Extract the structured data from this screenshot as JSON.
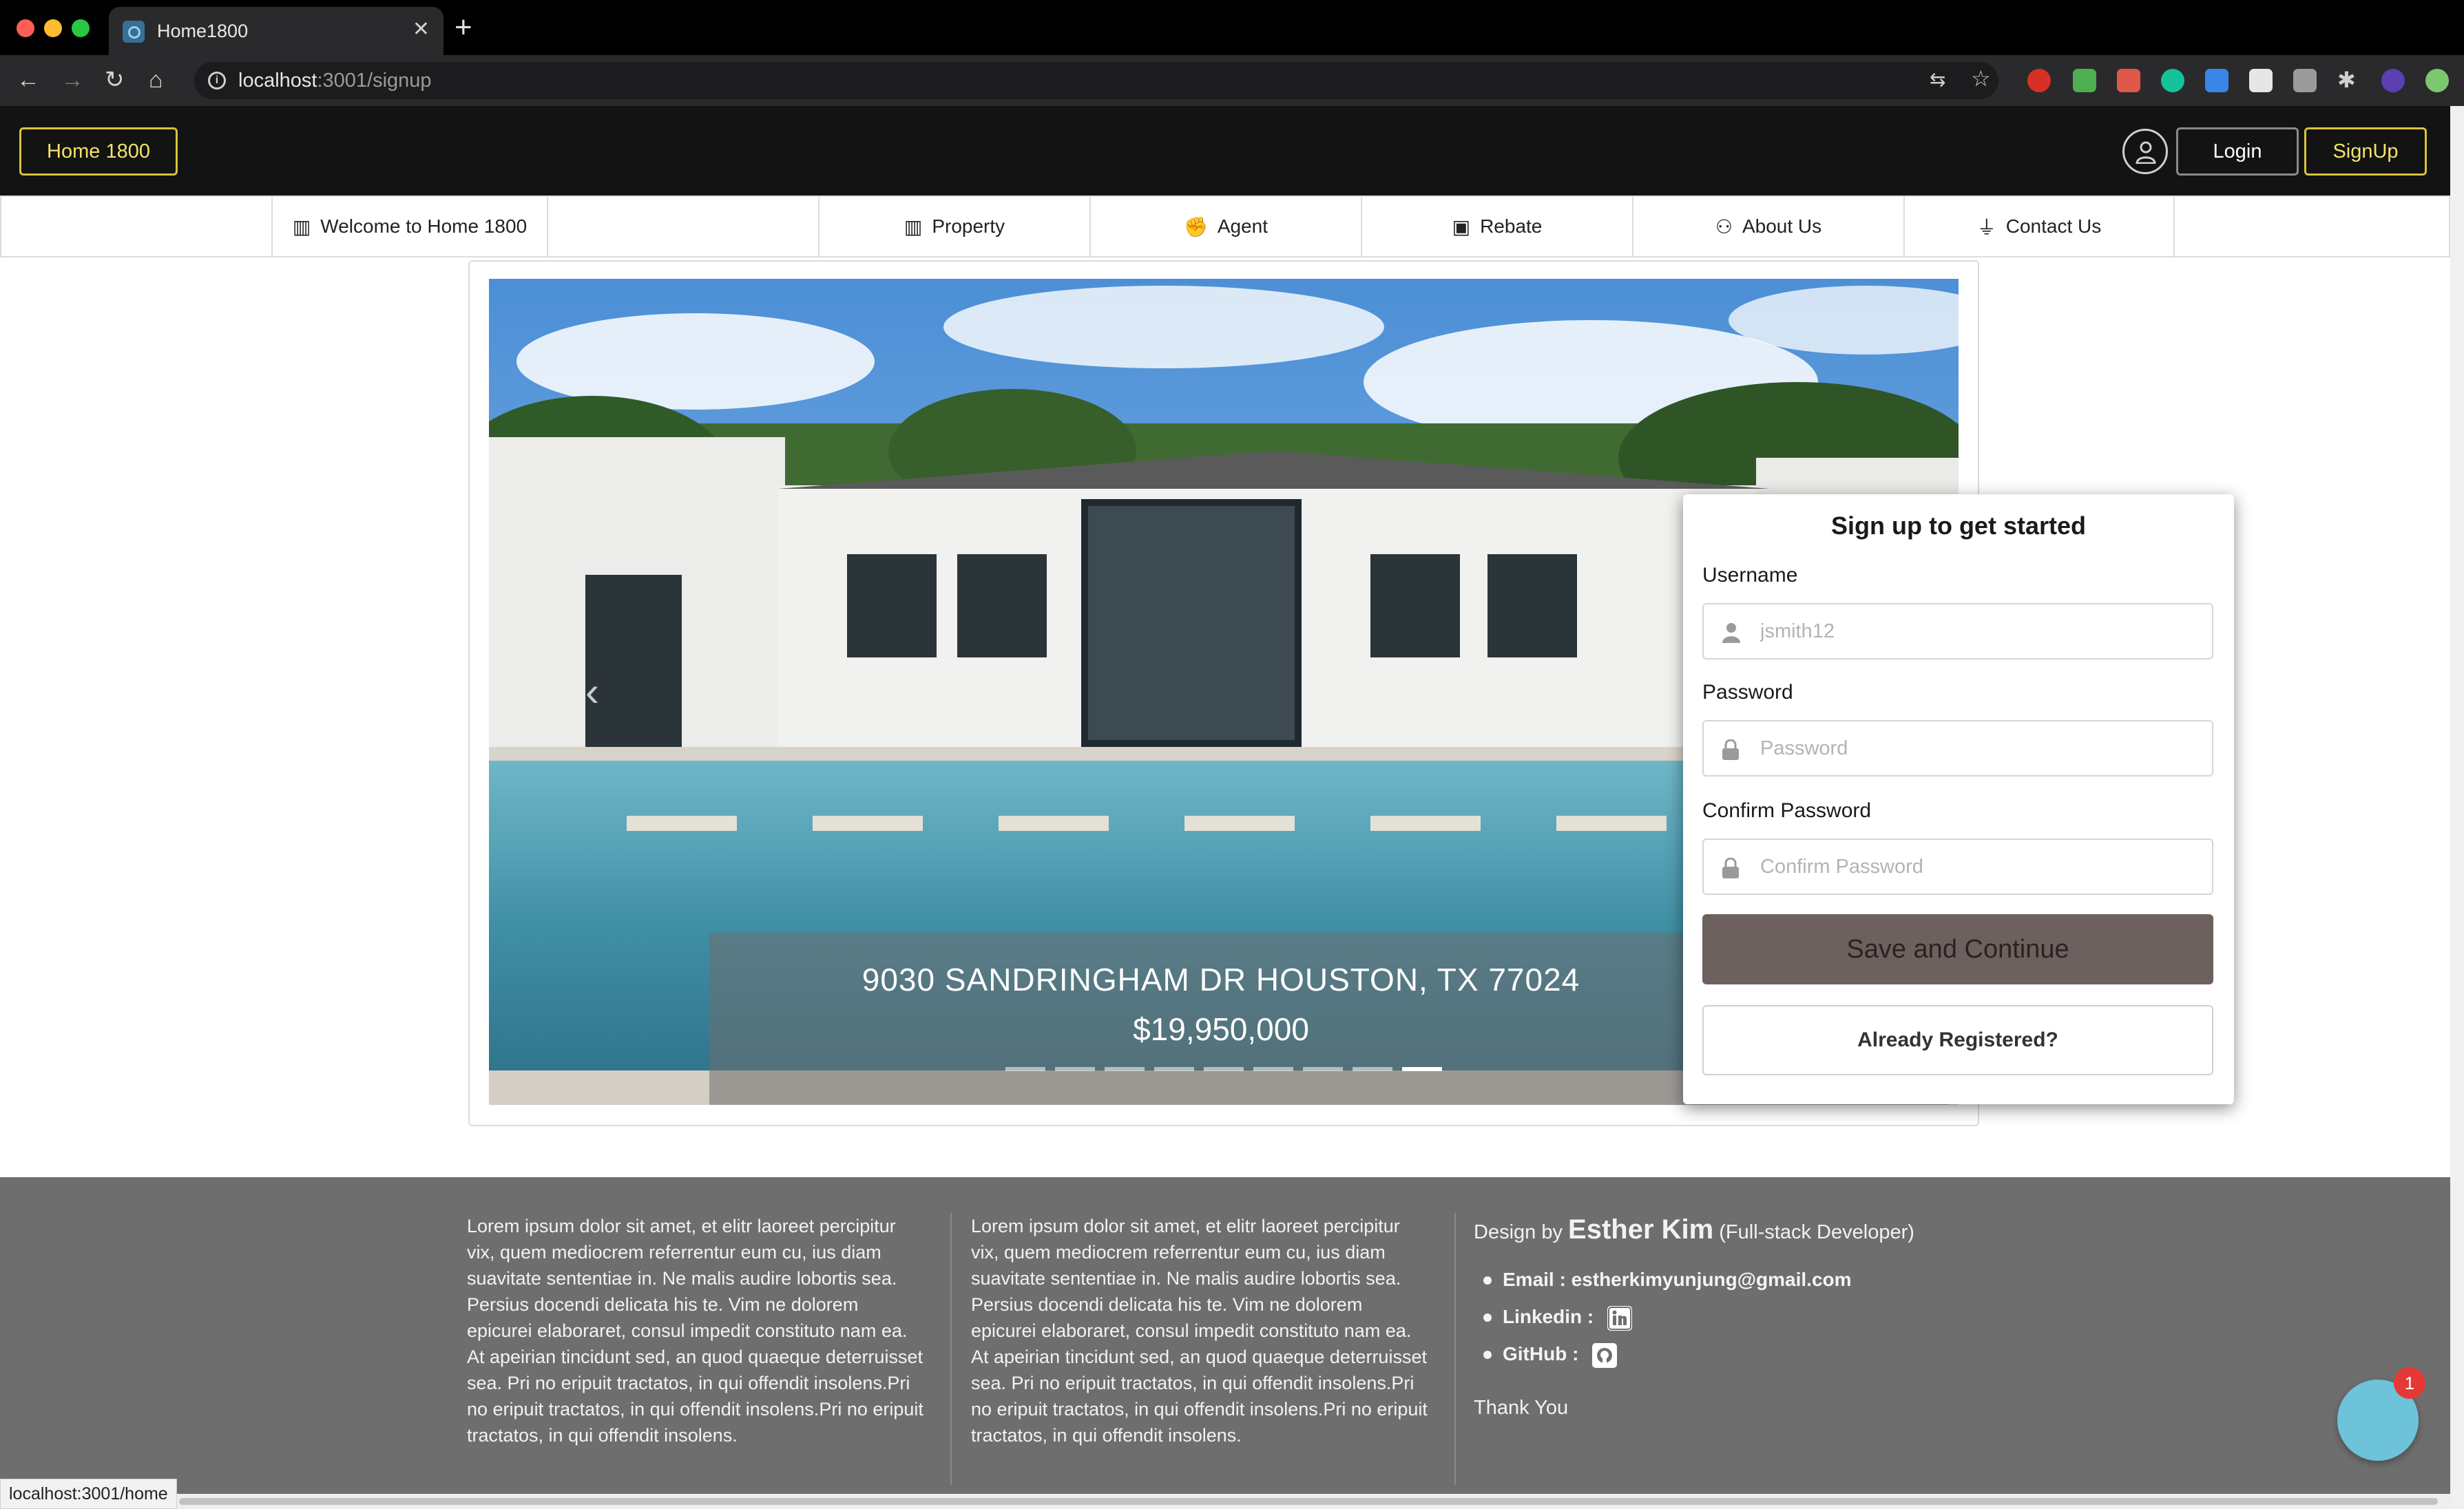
{
  "browser": {
    "tab_title": "Home1800",
    "url_host": "localhost",
    "url_path": ":3001/signup",
    "status_url": "localhost:3001/home",
    "traffic_colors": [
      "#ff5f57",
      "#febc2e",
      "#28c840"
    ]
  },
  "header": {
    "brand": "Home 1800",
    "login": "Login",
    "signup": "SignUp",
    "accent": "#d9c33a"
  },
  "menu": {
    "welcome": "Welcome to Home 1800",
    "property": "Property",
    "agent": "Agent",
    "rebate": "Rebate",
    "about": "About Us",
    "contact": "Contact Us"
  },
  "carousel": {
    "address": "9030 SANDRINGHAM DR HOUSTON, TX 77024",
    "price": "$19,950,000",
    "slide_count": 9,
    "active_index": 8
  },
  "signup_form": {
    "title": "Sign up to get started",
    "username_label": "Username",
    "username_placeholder": "jsmith12",
    "password_label": "Password",
    "password_placeholder": "Password",
    "confirm_label": "Confirm Password",
    "confirm_placeholder": "Confirm Password",
    "submit": "Save and Continue",
    "secondary": "Already Registered?"
  },
  "footer": {
    "lorem": "Lorem ipsum dolor sit amet, et elitr laoreet percipitur vix, quem mediocrem referrentur eum cu, ius diam suavitate sententiae in. Ne malis audire lobortis sea. Persius docendi delicata his te. Vim ne dolorem epicurei elaboraret, consul impedit constituto nam ea. At apeirian tincidunt sed, an quod quaeque deterruisset sea. Pri no eripuit tractatos, in qui offendit insolens.Pri no eripuit tractatos, in qui offendit insolens.Pri no eripuit tractatos, in qui offendit insolens.",
    "design_by": "Design by",
    "designer": "Esther Kim",
    "role": "(Full-stack Developer)",
    "email_label": "Email :",
    "email": "estherkimyunjung@gmail.com",
    "linkedin_label": "Linkedin :",
    "github_label": "GitHub :",
    "thanks": "Thank You"
  },
  "chat": {
    "badge_count": "1"
  }
}
